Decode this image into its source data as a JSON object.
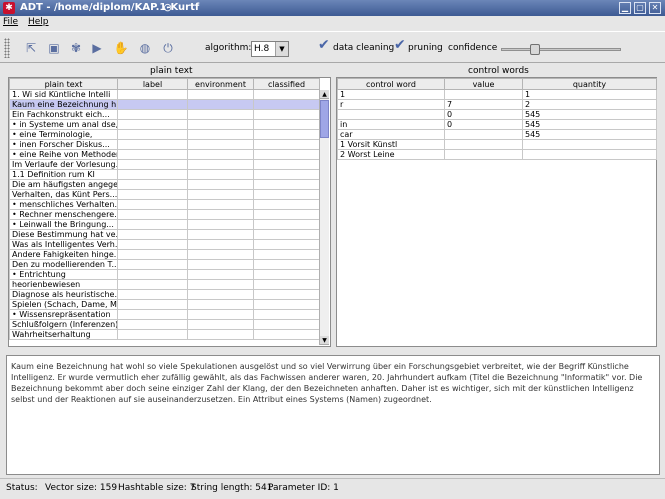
{
  "window": {
    "title": "ADT - /home/diplom/KAP.1-Kurtf",
    "menu": [
      "File",
      "Help"
    ]
  },
  "toolbar": {
    "icons": [
      "open-icon",
      "save-icon",
      "settings-icon",
      "play-icon",
      "stop-icon",
      "globe-icon",
      "power-icon"
    ],
    "algorithm_label": "algorithm:",
    "algorithm_value": "H.8",
    "data_cleaning_label": "data cleaning",
    "pruning_label": "pruning",
    "confidence_label": "confidence",
    "confidence_value": 0.25
  },
  "plain_text": {
    "title": "plain text",
    "columns": [
      "plain text",
      "label",
      "environment",
      "classified"
    ],
    "selected_index": 1,
    "rows": [
      "1. Wi sid Küntliche Intelli",
      "Kaum eine Bezeichnung h...",
      "Ein Fachkonstrukt eich...",
      "• in Systeme um anal dse,",
      "• eine Terminologie,",
      "• inen Forscher Diskus...",
      "• eine Reihe von Methoden.",
      "Im Verlaufe der Vorlesung...",
      "1.1 Definition rum KI",
      "Die am häufigsten angege...",
      "Verhalten, das Künt Pers...",
      "• menschliches Verhalten...",
      "• Rechner menschengere...",
      "• Leinwall the Bringung...",
      "Diese Bestimmung hat ve...",
      "Was als Intelligentes Verh...",
      "Andere Fahigkeiten hinge...",
      "Den zu modellierenden T...",
      "• Entrichtung",
      "  heorienbewiesen",
      "Diagnose als heuristische...",
      "Spielen (Schach, Dame, M...",
      "• Wissensrepräsentation",
      "Schlußfolgern (Inferenzen)",
      "Wahrheitserhaltung"
    ]
  },
  "control_words": {
    "title": "control words",
    "columns": [
      "control word",
      "value",
      "quantity"
    ],
    "rows": [
      [
        "1",
        "",
        "1"
      ],
      [
        "r",
        "7",
        "2"
      ],
      [
        "",
        "0",
        "545"
      ],
      [
        "in",
        "0",
        "545"
      ],
      [
        "car",
        "",
        "545"
      ],
      [
        "1 Vorsit Künstl",
        "",
        ""
      ],
      [
        "2 Worst Leine",
        "",
        ""
      ]
    ]
  },
  "text_area": "Kaum eine Bezeichnung hat wohl so viele Spekulationen ausgelöst und so viel Verwirrung über ein Forschungsgebiet verbreitet, wie der Begriff Künstliche Intelligenz. Er wurde vermutlich eher zufällig gewählt, als das Fachwissen anderer waren, 20. Jahrhundert aufkam (Titel die Bezeichnung \"Informatik\" vor. Die Bezeichnung bekommt aber doch seine einziger Zahl der Klang, der den Bezeichneten anhaften. Daher ist es wichtiger, sich mit der künstlichen Intelligenz selbst und der Reaktionen auf sie auseinanderzusetzen. Ein Attribut eines Systems (Namen) zugeordnet.",
  "status": {
    "label": "Status:",
    "vector_size": "Vector size: 159",
    "hashtable_size": "Hashtable size: 7",
    "string_length": "String length: 541",
    "parameter_id": "Parameter ID: 1"
  }
}
